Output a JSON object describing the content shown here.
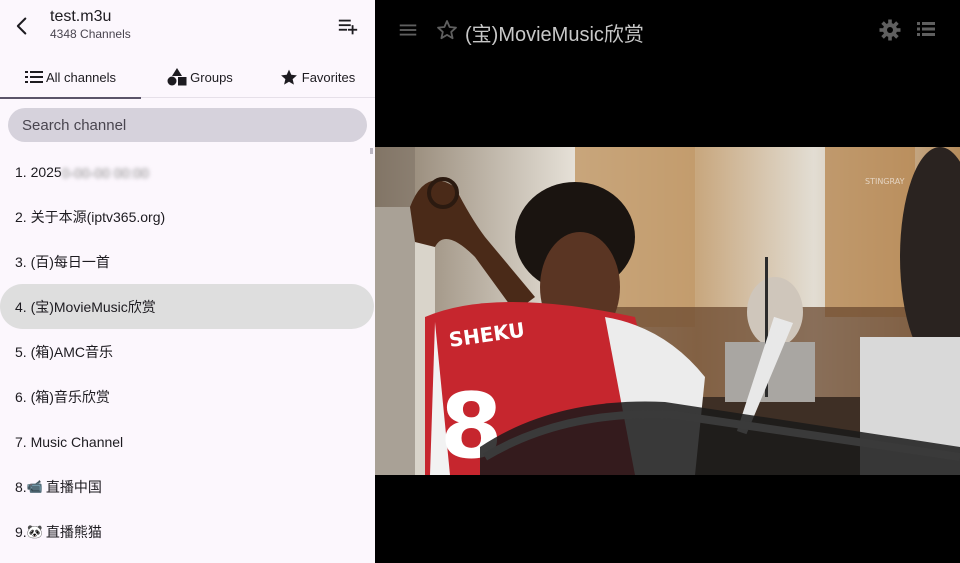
{
  "header": {
    "back_icon": "arrow-back-icon",
    "title": "test.m3u",
    "subtitle": "4348 Channels",
    "add_icon": "playlist-add-icon"
  },
  "tabs": [
    {
      "label": "All channels",
      "icon": "list-icon",
      "active": true
    },
    {
      "label": "Groups",
      "icon": "shapes-icon",
      "active": false
    },
    {
      "label": "Favorites",
      "icon": "star-icon",
      "active": false
    }
  ],
  "search": {
    "placeholder": "Search channel"
  },
  "channels": [
    {
      "label": "1. 2025",
      "blurred": "0-00-00 00:00"
    },
    {
      "label": "2. 关于本源(iptv365.org)"
    },
    {
      "label": "3. (百)每日一首"
    },
    {
      "label": "4. (宝)MovieMusic欣赏",
      "selected": true
    },
    {
      "label": "5. (箱)AMC音乐"
    },
    {
      "label": "6. (箱)音乐欣赏"
    },
    {
      "label": "7. Music Channel"
    },
    {
      "label": "8. ",
      "emoji": "📹",
      "tail": "直播中国"
    },
    {
      "label": "9. ",
      "emoji": "🐼",
      "tail": "直播熊猫"
    }
  ],
  "player": {
    "menu_icon": "menu-icon",
    "favorite_icon": "star-outline-icon",
    "title": "(宝)MovieMusic欣赏",
    "settings_icon": "gear-icon",
    "list_icon": "list-view-icon",
    "jersey_name": "SHEKU",
    "jersey_number": "8",
    "watermark": "STINGRAY"
  },
  "colors": {
    "panel_bg": "#fcf7fd",
    "search_bg": "#d6d2dc",
    "selected_bg": "#dedede",
    "jersey_red": "#c6262e"
  }
}
